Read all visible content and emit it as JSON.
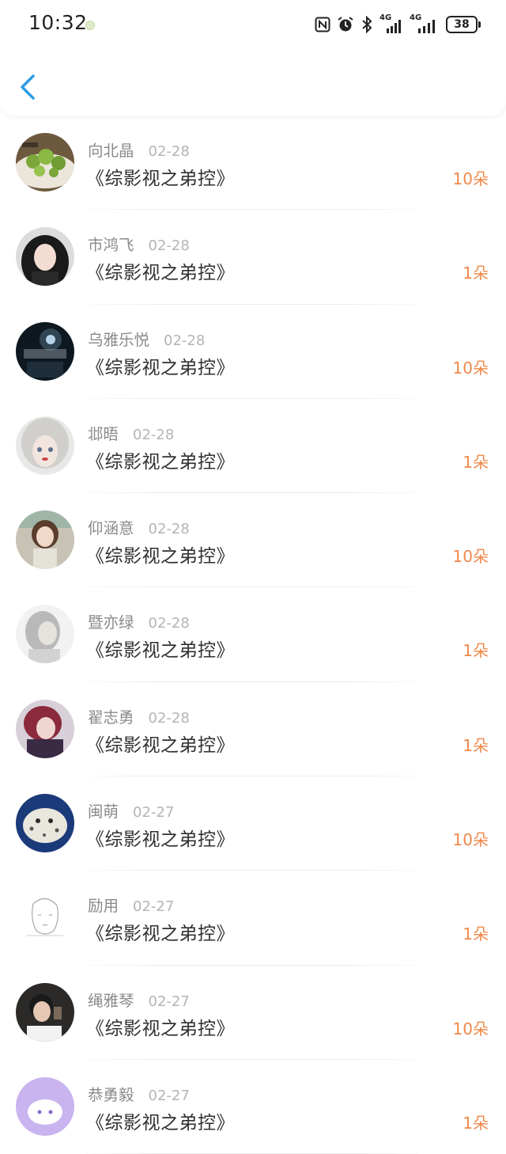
{
  "status_bar": {
    "time": "10:32",
    "network_1": "4G",
    "network_2": "4G",
    "battery": "38"
  },
  "header": {
    "back_icon": "chevron-left-icon",
    "accent_color": "#2e9be6"
  },
  "gift_list": {
    "amount_color": "#f0884a",
    "items": [
      {
        "name": "向北晶",
        "date": "02-28",
        "book": "《综影视之弟控》",
        "amount": "10朵",
        "avatar": "food-photo"
      },
      {
        "name": "市鸿飞",
        "date": "02-28",
        "book": "《综影视之弟控》",
        "amount": "1朵",
        "avatar": "girl-portrait"
      },
      {
        "name": "乌雅乐悦",
        "date": "02-28",
        "book": "《综影视之弟控》",
        "amount": "10朵",
        "avatar": "dark-night-art"
      },
      {
        "name": "邶晤",
        "date": "02-28",
        "book": "《综影视之弟控》",
        "amount": "1朵",
        "avatar": "doll-face"
      },
      {
        "name": "仰涵意",
        "date": "02-28",
        "book": "《综影视之弟控》",
        "amount": "10朵",
        "avatar": "street-girl"
      },
      {
        "name": "暨亦绿",
        "date": "02-28",
        "book": "《综影视之弟控》",
        "amount": "1朵",
        "avatar": "faded-portrait"
      },
      {
        "name": "翟志勇",
        "date": "02-28",
        "book": "《综影视之弟控》",
        "amount": "1朵",
        "avatar": "red-hair-girl"
      },
      {
        "name": "闽萌",
        "date": "02-27",
        "book": "《综影视之弟控》",
        "amount": "10朵",
        "avatar": "snow-leopard"
      },
      {
        "name": "励用",
        "date": "02-27",
        "book": "《综影视之弟控》",
        "amount": "1朵",
        "avatar": "line-sketch"
      },
      {
        "name": "绳雅琴",
        "date": "02-27",
        "book": "《综影视之弟控》",
        "amount": "10朵",
        "avatar": "boy-portrait"
      },
      {
        "name": "恭勇毅",
        "date": "02-27",
        "book": "《综影视之弟控》",
        "amount": "1朵",
        "avatar": "purple-cartoon"
      }
    ]
  }
}
